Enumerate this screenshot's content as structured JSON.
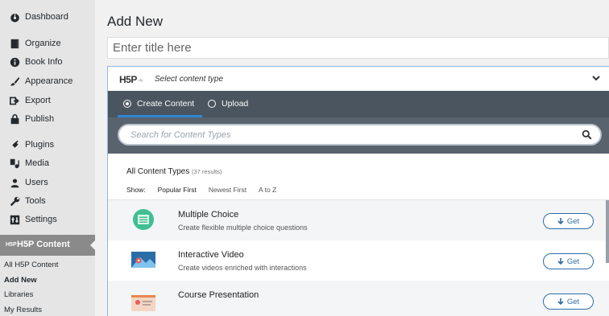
{
  "sidebar": {
    "items": [
      {
        "label": "Dashboard",
        "icon": "dashboard-icon"
      },
      {
        "label": "Organize",
        "icon": "book-icon"
      },
      {
        "label": "Book Info",
        "icon": "info-icon"
      },
      {
        "label": "Appearance",
        "icon": "brush-icon"
      },
      {
        "label": "Export",
        "icon": "export-icon"
      },
      {
        "label": "Publish",
        "icon": "cart-icon"
      },
      {
        "label": "Plugins",
        "icon": "plug-icon"
      },
      {
        "label": "Media",
        "icon": "media-icon"
      },
      {
        "label": "Users",
        "icon": "users-icon"
      },
      {
        "label": "Tools",
        "icon": "wrench-icon"
      },
      {
        "label": "Settings",
        "icon": "settings-icon"
      }
    ],
    "active": {
      "label": "H5P Content",
      "icon_text": "H5P"
    },
    "submenu": [
      "All H5P Content",
      "Add New",
      "Libraries",
      "My Results"
    ]
  },
  "page": {
    "title": "Add New",
    "title_placeholder": "Enter title here"
  },
  "panel": {
    "logo": "H5P",
    "logo_suffix": ".org",
    "select_label": "Select content type",
    "tabs": [
      {
        "label": "Create Content",
        "selected": true
      },
      {
        "label": "Upload",
        "selected": false
      }
    ],
    "search_placeholder": "Search for Content Types",
    "types_title": "All Content Types",
    "types_count": "(37 results)",
    "show_label": "Show:",
    "sort_options": [
      "Popular First",
      "Newest First",
      "A to Z"
    ],
    "items": [
      {
        "title": "Multiple Choice",
        "description": "Create flexible multiple choice questions",
        "button": "Get"
      },
      {
        "title": "Interactive Video",
        "description": "Create videos enriched with interactions",
        "button": "Get"
      },
      {
        "title": "Course Presentation",
        "description": "",
        "button": "Get"
      }
    ]
  },
  "colors": {
    "tabbar": "#4a5560",
    "search_bg": "#58636e",
    "accent_blue": "#2f86d4",
    "button_blue": "#2f6ca8",
    "sidebar_active": "#8a8a8a"
  }
}
